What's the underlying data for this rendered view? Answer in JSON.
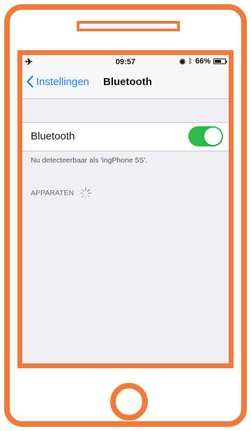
{
  "status_bar": {
    "time": "09:57",
    "battery_percent": "66%",
    "battery_level": 0.66
  },
  "nav": {
    "back_label": "Instellingen",
    "title": "Bluetooth"
  },
  "bluetooth_cell": {
    "label": "Bluetooth",
    "enabled": true
  },
  "discoverable_note": "Nu detecteerbaar als 'ingPhone 5S'.",
  "devices_section": {
    "header": "APPARATEN"
  },
  "colors": {
    "frame": "#f07a3a",
    "accent": "#1b7cf2",
    "toggle_on": "#2dbb4a"
  }
}
